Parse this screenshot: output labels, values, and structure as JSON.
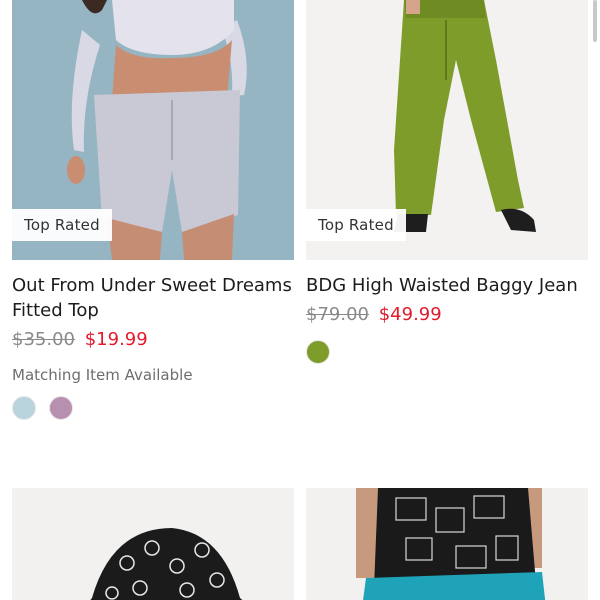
{
  "products": [
    {
      "badge": "Top Rated",
      "title": "Out From Under Sweet Dreams Fitted Top",
      "original_price": "$35.00",
      "sale_price": "$19.99",
      "matching_text": "Matching Item Available",
      "swatches": [
        "#b9d3dd",
        "#b78fb0"
      ]
    },
    {
      "badge": "Top Rated",
      "title": "BDG High Waisted Baggy Jean",
      "original_price": "$79.00",
      "sale_price": "$49.99",
      "swatches": [
        "#7d9c2a"
      ]
    }
  ],
  "colors": {
    "sale_price": "#e21a2c",
    "original_price": "#8a8a8a"
  }
}
